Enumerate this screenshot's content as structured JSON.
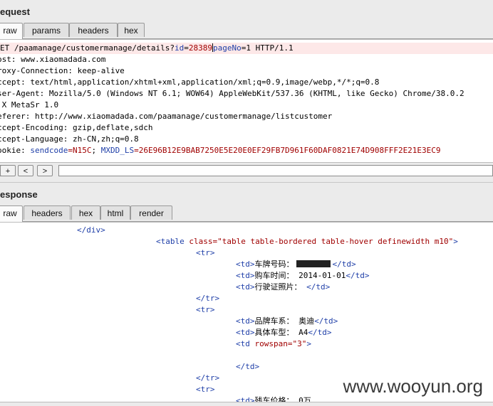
{
  "request": {
    "title": "equest",
    "tabs": [
      "raw",
      "params",
      "headers",
      "hex"
    ],
    "active_tab": "raw",
    "lines": {
      "l1_a": "ET /paamanage/customermanage/details?",
      "l1_k": "id",
      "l1_eq": "=",
      "l1_v": "28389",
      "l1_k2": "pageNo",
      "l1_eq2": "=1 HTTP/1.1",
      "l2": "ost: www.xiaomadada.com",
      "l3": "roxy-Connection: keep-alive",
      "l4": "ccept: text/html,application/xhtml+xml,application/xml;q=0.9,image/webp,*/*;q=0.8",
      "l5": "ser-Agent: Mozilla/5.0 (Windows NT 6.1; WOW64) AppleWebKit/537.36 (KHTML, like Gecko) Chrome/38.0.2",
      "l6": ".X MetaSr 1.0",
      "l7": "eferer: http://www.xiaomadada.com/paamanage/customermanage/listcustomer",
      "l8": "ccept-Encoding: gzip,deflate,sdch",
      "l9": "ccept-Language: zh-CN,zh;q=0.8",
      "l10_a": "ookie: ",
      "l10_k1": "sendcode",
      "l10_v1": "=N15C",
      "l10_sep": "; ",
      "l10_k2": "MXDD_LS",
      "l10_v2": "=26E96B12E9BAB7250E5E20E0EF29FB7D961F60DAF0821E74D908FFF2E21E3EC9"
    },
    "toolbar": {
      "help": "?",
      "plus": "+",
      "prev": "<",
      "next": ">"
    }
  },
  "response": {
    "title": "esponse",
    "tabs": [
      "raw",
      "headers",
      "hex",
      "html",
      "render"
    ],
    "active_tab": "raw",
    "lines": {
      "r1": "</div>",
      "r2_tag": "<table ",
      "r2_attr": "class",
      "r2_val": "=\"table table-bordered table-hover definewidth m10\"",
      "r2_end": ">",
      "r3": "<tr>",
      "r4_o": "<td>",
      "r4_t": "车牌号码：",
      "r4_c": "</td>",
      "r5_o": "<td>",
      "r5_t": "购车时间： 2014-01-01",
      "r5_c": "</td>",
      "r6_o": "<td>",
      "r6_t": "行驶证照片： ",
      "r6_c": "</td>",
      "r7": "</tr>",
      "r8": "<tr>",
      "r9_o": "<td>",
      "r9_t": "品牌车系： 奥迪",
      "r9_c": "</td>",
      "r10_o": "<td>",
      "r10_t": "具体车型： A4",
      "r10_c": "</td>",
      "r11_tag": "<td ",
      "r11_attr": "rowspan",
      "r11_val": "=\"3\"",
      "r11_end": ">",
      "r12": "</td>",
      "r13": "</tr>",
      "r14": "<tr>",
      "r15_o": "<td>",
      "r15_t": "残车价格： 0万"
    }
  },
  "watermark": "www.wooyun.org"
}
